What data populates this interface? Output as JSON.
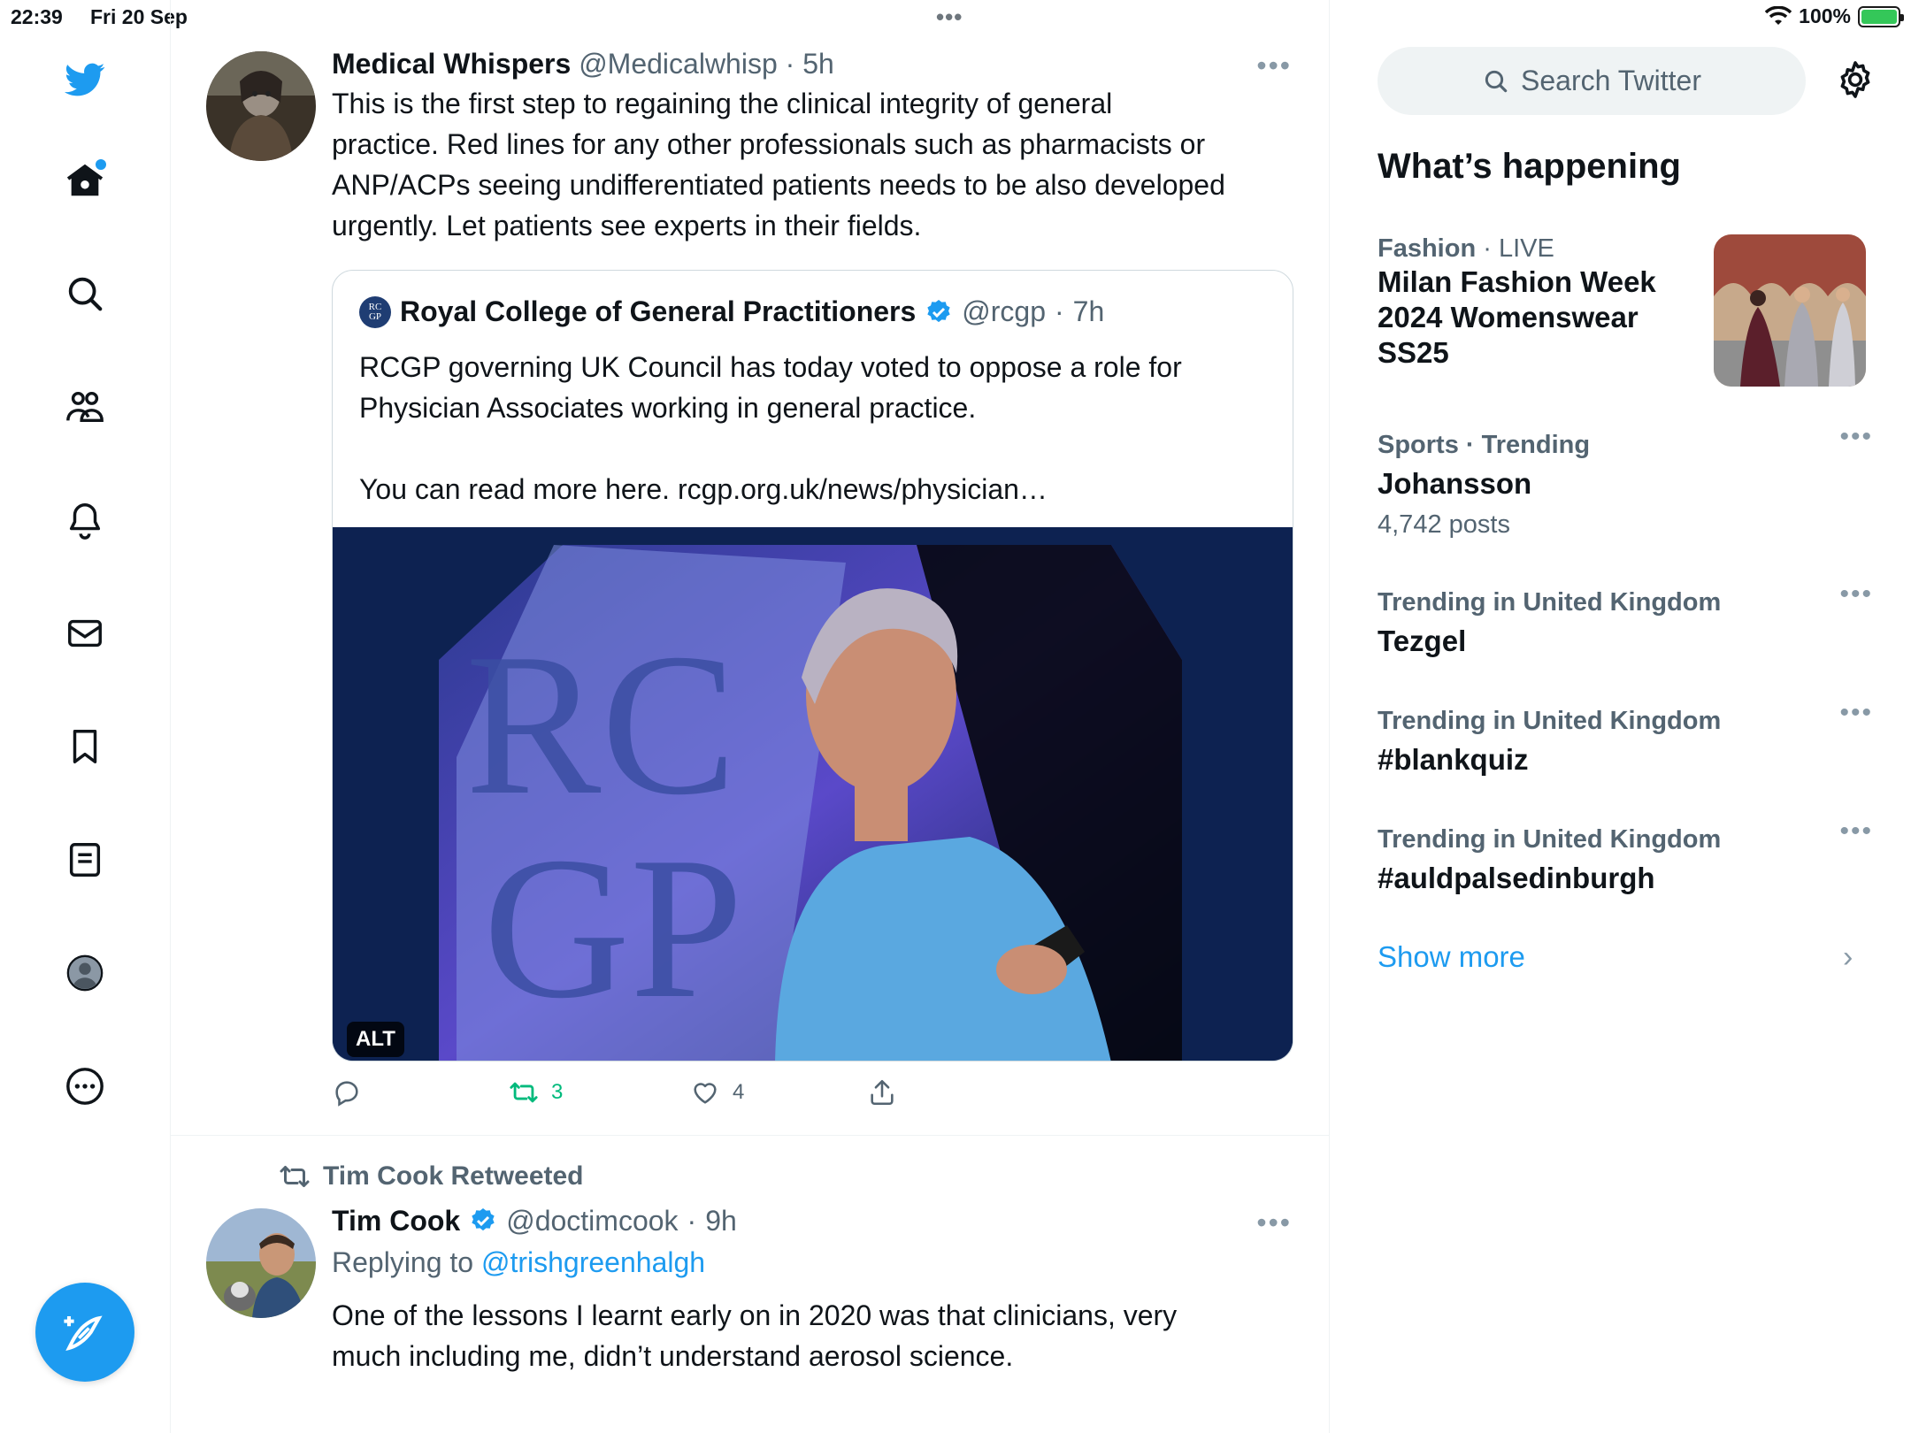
{
  "status_bar": {
    "time": "22:39",
    "date": "Fri 20 Sep",
    "battery": "100%",
    "battery_level": 1.0,
    "battery_color": "#34c759"
  },
  "nav": {
    "items": [
      {
        "icon": "twitter-logo-icon"
      },
      {
        "icon": "home-icon",
        "badge": true
      },
      {
        "icon": "search-icon"
      },
      {
        "icon": "communities-icon"
      },
      {
        "icon": "bell-icon"
      },
      {
        "icon": "mail-icon"
      },
      {
        "icon": "bookmark-icon"
      },
      {
        "icon": "lists-icon"
      },
      {
        "icon": "profile-icon"
      },
      {
        "icon": "more-circle-icon"
      }
    ],
    "compose_icon": "compose-feather-icon"
  },
  "feed": {
    "tweet1": {
      "name": "Medical Whispers",
      "handle": "@Medicalwhisp",
      "time": "5h",
      "text_lines": [
        "This is the first step to regaining the clinical integrity of general",
        "practice. Red lines for any other professionals such as pharmacists or",
        "ANP/ACPs seeing undifferentiated patients needs to be also developed",
        "urgently. Let patients see experts in their fields."
      ],
      "quote": {
        "name": "Royal College of General Practitioners",
        "logo_text_1": "RC",
        "logo_text_2": "GP",
        "handle": "@rcgp",
        "time": "7h",
        "text_lines": [
          "RCGP governing UK Council has today voted to oppose a role for",
          "Physician Associates working in general practice."
        ],
        "link_line": "You can read more here. rcgp.org.uk/news/physician…",
        "image_text_1": "RC",
        "image_text_2": "GP",
        "alt_badge": "ALT"
      },
      "retweets": "3",
      "likes": "4"
    },
    "tweet2": {
      "retweeted_by": "Tim Cook Retweeted",
      "name": "Tim Cook",
      "handle": "@doctimcook",
      "time": "9h",
      "replying_prefix": "Replying to",
      "replying_to": "@trishgreenhalgh",
      "text_lines": [
        "One of the lessons I learnt early on in 2020 was that clinicians, very",
        "much including me, didn’t understand aerosol science."
      ]
    }
  },
  "sidebar": {
    "search_placeholder": "Search Twitter",
    "whats_happening": "What’s happening",
    "trends": [
      {
        "category": "Fashion",
        "tag": "LIVE",
        "title_lines": [
          "Milan Fashion Week",
          "2024 Womenswear",
          "SS25"
        ]
      },
      {
        "category": "Sports · Trending",
        "title": "Johansson",
        "posts": "4,742 posts"
      },
      {
        "category": "Trending in United Kingdom",
        "title": "Tezgel"
      },
      {
        "category": "Trending in United Kingdom",
        "title": "#blankquiz"
      },
      {
        "category": "Trending in United Kingdom",
        "title": "#auldpalsedinburgh"
      }
    ],
    "show_more": "Show more"
  },
  "colors": {
    "accent": "#1d9bf0",
    "retweet_green": "#00ba7c",
    "text_secondary": "#536471"
  }
}
